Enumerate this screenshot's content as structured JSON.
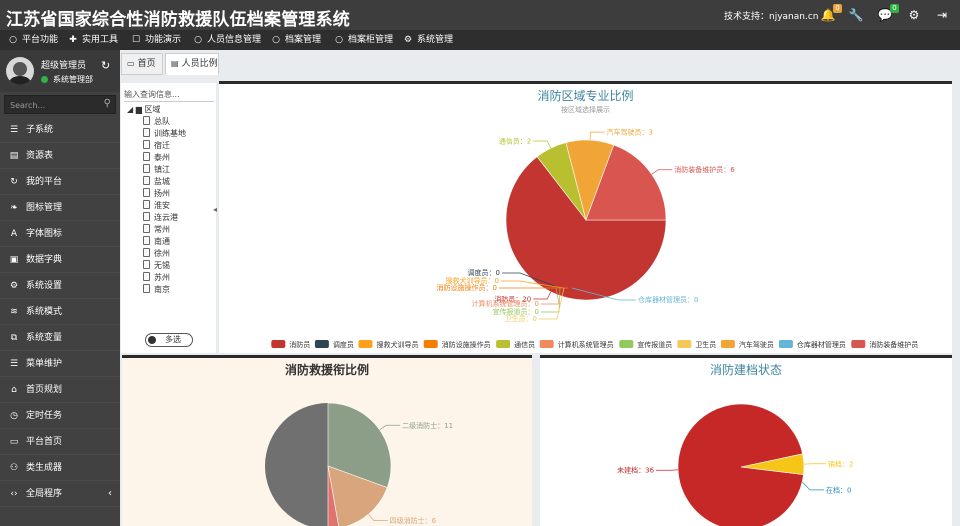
{
  "app": {
    "title": "江苏省国家综合性消防救援队伍档案管理系统",
    "support": "技术支持：njyanan.cn"
  },
  "topbar_icons": [
    {
      "name": "bell-icon",
      "glyph": "🔔",
      "badge": "0",
      "badge_color": "#e6a23c"
    },
    {
      "name": "wrench-icon",
      "glyph": "🔧",
      "badge": "",
      "badge_color": ""
    },
    {
      "name": "chat-icon",
      "glyph": "💬",
      "badge": "0",
      "badge_color": "#2fb344"
    },
    {
      "name": "gears-icon",
      "glyph": "⚙",
      "badge": "",
      "badge_color": ""
    },
    {
      "name": "sign-out-icon",
      "glyph": "⇥",
      "badge": "",
      "badge_color": ""
    }
  ],
  "menubar": [
    {
      "label": "平台功能",
      "icon": "circle-icon",
      "glyph": "○"
    },
    {
      "label": "实用工具",
      "icon": "puzzle-icon",
      "glyph": "✚"
    },
    {
      "label": "功能演示",
      "icon": "square-icon",
      "glyph": "☐"
    },
    {
      "label": "人员信息管理",
      "icon": "circle-icon",
      "glyph": "○"
    },
    {
      "label": "档案管理",
      "icon": "circle-icon",
      "glyph": "○"
    },
    {
      "label": "档案柜管理",
      "icon": "circle-icon",
      "glyph": "○"
    },
    {
      "label": "系统管理",
      "icon": "gear-icon",
      "glyph": "⚙"
    }
  ],
  "user": {
    "name": "超级管理员",
    "role": "系统管理部"
  },
  "sidebar": {
    "search_placeholder": "Search...",
    "items": [
      {
        "label": "子系统",
        "icon": "list-icon",
        "glyph": "☰"
      },
      {
        "label": "资源表",
        "icon": "database-icon",
        "glyph": "▤"
      },
      {
        "label": "我的平台",
        "icon": "refresh-icon",
        "glyph": "↻"
      },
      {
        "label": "图标管理",
        "icon": "leaf-icon",
        "glyph": "❧"
      },
      {
        "label": "字体图标",
        "icon": "font-icon",
        "glyph": "A"
      },
      {
        "label": "数据字典",
        "icon": "book-icon",
        "glyph": "▣"
      },
      {
        "label": "系统设置",
        "icon": "gear-icon",
        "glyph": "⚙"
      },
      {
        "label": "系统模式",
        "icon": "sliders-icon",
        "glyph": "≋"
      },
      {
        "label": "系统变量",
        "icon": "sitemap-icon",
        "glyph": "⧉"
      },
      {
        "label": "菜单维护",
        "icon": "list-icon",
        "glyph": "☰"
      },
      {
        "label": "首页规划",
        "icon": "home-icon",
        "glyph": "⌂"
      },
      {
        "label": "定时任务",
        "icon": "history-icon",
        "glyph": "◷"
      },
      {
        "label": "平台首页",
        "icon": "window-icon",
        "glyph": "▭"
      },
      {
        "label": "类生成器",
        "icon": "robot-icon",
        "glyph": "⚇"
      },
      {
        "label": "全局程序",
        "icon": "code-icon",
        "glyph": "‹›"
      }
    ]
  },
  "tabs": [
    {
      "label": "首页",
      "icon": "window-icon",
      "glyph": "▭"
    },
    {
      "label": "人员比例",
      "icon": "file-icon",
      "glyph": "▤"
    }
  ],
  "tree": {
    "search_placeholder": "输入查询信息...",
    "root": "区域",
    "nodes": [
      "总队",
      "训练基地",
      "宿迁",
      "泰州",
      "镇江",
      "盐城",
      "扬州",
      "淮安",
      "连云港",
      "常州",
      "南通",
      "徐州",
      "无锡",
      "苏州",
      "南京"
    ],
    "multi_select_label": "多选"
  },
  "chart_data": [
    {
      "type": "pie",
      "title": "消防区域专业比例",
      "subtitle": "按区域选择展示",
      "legend_position": "bottom",
      "categories": [
        "消防员",
        "调度员",
        "搜救犬训导员",
        "消防设施操作员",
        "通信员",
        "计算机系统管理员",
        "宣传报道员",
        "卫生员",
        "汽车驾驶员",
        "仓库器材管理员",
        "消防装备维护员"
      ],
      "values": [
        20,
        0,
        0,
        0,
        2,
        0,
        0,
        0,
        3,
        0,
        6
      ],
      "colors": [
        "#c23531",
        "#2f4554",
        "#ff9f1c",
        "#f57c00",
        "#b8c030",
        "#f08a5d",
        "#91c95b",
        "#f5c85a",
        "#f2a537",
        "#64b5d6",
        "#d95550"
      ]
    },
    {
      "type": "pie",
      "title": "消防救援衔比例",
      "categories": [
        "二级消防士",
        "四级消防士",
        ""
      ],
      "values": [
        11,
        6,
        1
      ],
      "point_labels": [
        "二级消防士：11",
        "四级消防士：6",
        "：1"
      ],
      "colors": [
        "#8c9e88",
        "#d9a57d",
        "#e0726f"
      ],
      "hole_color": "#707070"
    },
    {
      "type": "pie",
      "title": "消防建档状态",
      "categories": [
        "未建档",
        "销档",
        "在档"
      ],
      "values": [
        36,
        2,
        0
      ],
      "colors": [
        "#c62828",
        "#f5c518",
        "#2a8db8"
      ]
    }
  ]
}
